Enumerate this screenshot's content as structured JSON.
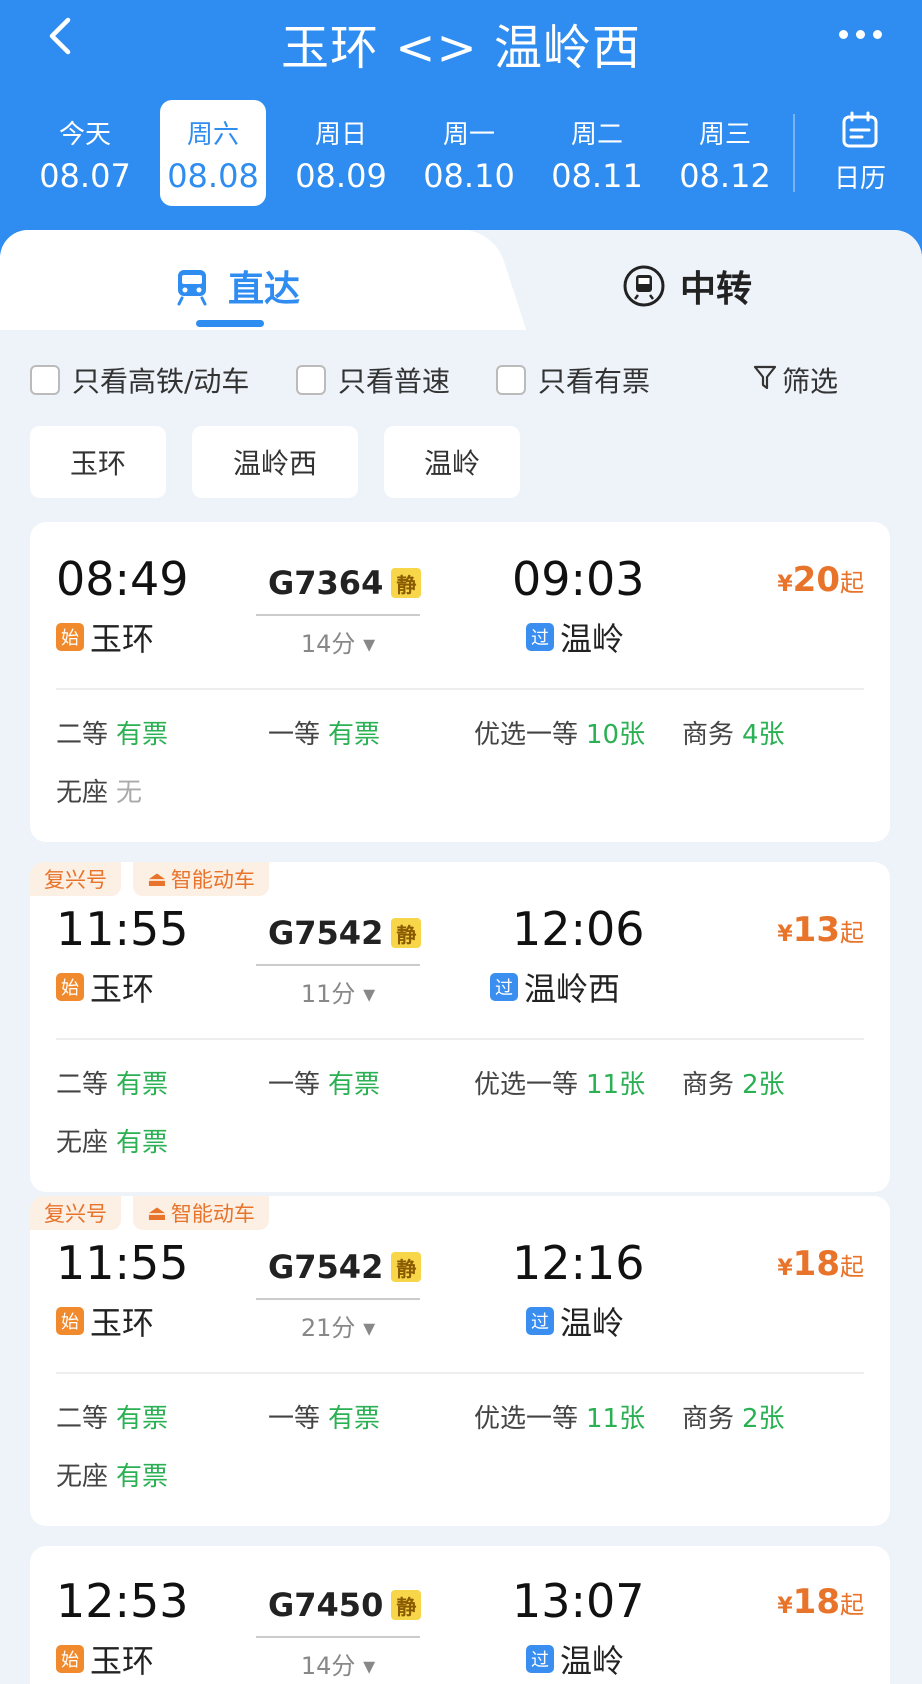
{
  "header": {
    "title": "玉环 <> 温岭西",
    "dates": [
      {
        "weekday": "今天",
        "date": "08.07"
      },
      {
        "weekday": "周六",
        "date": "08.08"
      },
      {
        "weekday": "周日",
        "date": "08.09"
      },
      {
        "weekday": "周一",
        "date": "08.10"
      },
      {
        "weekday": "周二",
        "date": "08.11"
      },
      {
        "weekday": "周三",
        "date": "08.12"
      }
    ],
    "selected_date_index": 1,
    "calendar_label": "日历"
  },
  "tabs": {
    "direct": "直达",
    "transfer": "中转"
  },
  "filters": {
    "high_speed": "只看高铁/动车",
    "normal": "只看普速",
    "available": "只看有票",
    "filter": "筛选"
  },
  "stations": [
    "玉环",
    "温岭西",
    "温岭"
  ],
  "trains": [
    {
      "tags": [],
      "dep_time": "08:49",
      "dep_station": "玉环",
      "dep_badge": "始",
      "train_no": "G7364",
      "quiet": "静",
      "duration": "14分",
      "arr_time": "09:03",
      "arr_station": "温岭",
      "arr_badge": "过",
      "price_unit": "¥",
      "price": "20",
      "price_suffix": "起",
      "seats": {
        "second": {
          "label": "二等",
          "value": "有票"
        },
        "first": {
          "label": "一等",
          "value": "有票"
        },
        "premium": {
          "label": "优选一等",
          "value": "10张"
        },
        "business": {
          "label": "商务",
          "value": "4张"
        },
        "standing": {
          "label": "无座",
          "value": "无"
        }
      }
    },
    {
      "tags": [
        "复兴号",
        "智能动车"
      ],
      "dep_time": "11:55",
      "dep_station": "玉环",
      "dep_badge": "始",
      "train_no": "G7542",
      "quiet": "静",
      "duration": "11分",
      "arr_time": "12:06",
      "arr_station": "温岭西",
      "arr_badge": "过",
      "price_unit": "¥",
      "price": "13",
      "price_suffix": "起",
      "seats": {
        "second": {
          "label": "二等",
          "value": "有票"
        },
        "first": {
          "label": "一等",
          "value": "有票"
        },
        "premium": {
          "label": "优选一等",
          "value": "11张"
        },
        "business": {
          "label": "商务",
          "value": "2张"
        },
        "standing": {
          "label": "无座",
          "value": "有票"
        }
      }
    },
    {
      "tags": [
        "复兴号",
        "智能动车"
      ],
      "dep_time": "11:55",
      "dep_station": "玉环",
      "dep_badge": "始",
      "train_no": "G7542",
      "quiet": "静",
      "duration": "21分",
      "arr_time": "12:16",
      "arr_station": "温岭",
      "arr_badge": "过",
      "price_unit": "¥",
      "price": "18",
      "price_suffix": "起",
      "seats": {
        "second": {
          "label": "二等",
          "value": "有票"
        },
        "first": {
          "label": "一等",
          "value": "有票"
        },
        "premium": {
          "label": "优选一等",
          "value": "11张"
        },
        "business": {
          "label": "商务",
          "value": "2张"
        },
        "standing": {
          "label": "无座",
          "value": "有票"
        }
      }
    },
    {
      "tags": [],
      "dep_time": "12:53",
      "dep_station": "玉环",
      "dep_badge": "始",
      "train_no": "G7450",
      "quiet": "静",
      "duration": "14分",
      "arr_time": "13:07",
      "arr_station": "温岭",
      "arr_badge": "过",
      "price_unit": "¥",
      "price": "18",
      "price_suffix": "起"
    }
  ],
  "colors": {
    "primary": "#2f8cf0",
    "price": "#e8732a",
    "available": "#2bb053"
  }
}
